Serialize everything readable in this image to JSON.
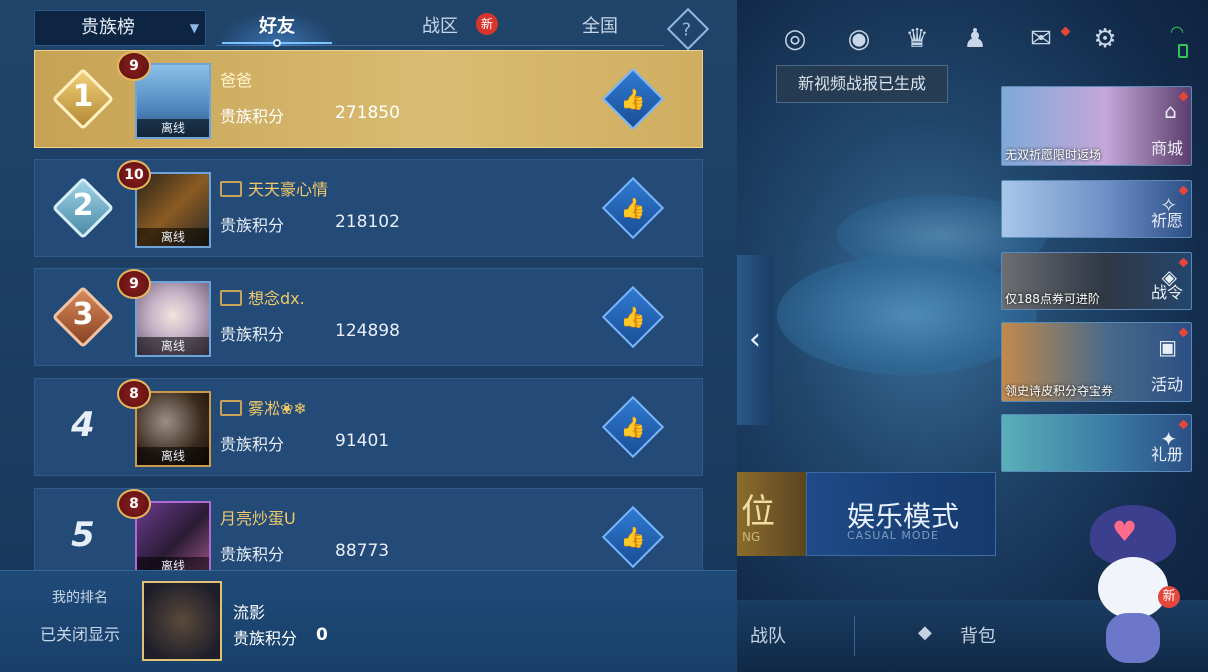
{
  "header": {
    "scope_select": "贵族榜",
    "tabs": [
      {
        "label": "好友"
      },
      {
        "label": "战区"
      },
      {
        "label": "全国"
      }
    ],
    "new_badge": "新",
    "help": "?"
  },
  "rows": [
    {
      "rank": "1",
      "level": "9",
      "status": "离线",
      "name": "爸爸",
      "score_label": "贵族积分",
      "score": "271850"
    },
    {
      "rank": "2",
      "level": "10",
      "status": "离线",
      "name": "天天豪心情",
      "score_label": "贵族积分",
      "score": "218102"
    },
    {
      "rank": "3",
      "level": "9",
      "status": "离线",
      "name": "想念dx.",
      "score_label": "贵族积分",
      "score": "124898"
    },
    {
      "rank": "4",
      "level": "8",
      "status": "离线",
      "name": "雾凇❀❄",
      "score_label": "贵族积分",
      "score": "91401"
    },
    {
      "rank": "5",
      "level": "8",
      "status": "离线",
      "name": "月亮炒蛋U",
      "score_label": "贵族积分",
      "score": "88773"
    }
  ],
  "my_rank": {
    "label": "我的排名",
    "hidden_text": "已关闭显示",
    "name": "流影",
    "score_label": "贵族积分",
    "score": "0"
  },
  "right": {
    "tooltip": "新视频战报已生成",
    "side_cards": [
      {
        "caption": "无双祈愿限时返场",
        "label": "商城"
      },
      {
        "caption": "",
        "label": "祈愿"
      },
      {
        "caption": "仅188点券可进阶",
        "label": "战令"
      },
      {
        "caption": "领史诗皮积分夺宝券",
        "label": "活动"
      },
      {
        "caption": "",
        "label": "礼册"
      }
    ],
    "mode_left": "位",
    "mode_left_sub": "NG",
    "mode_casual": "娱乐模式",
    "mode_casual_sub": "CASUAL MODE",
    "bottom_team": "战队",
    "bottom_bag": "背包",
    "mascot_badge": "新"
  }
}
